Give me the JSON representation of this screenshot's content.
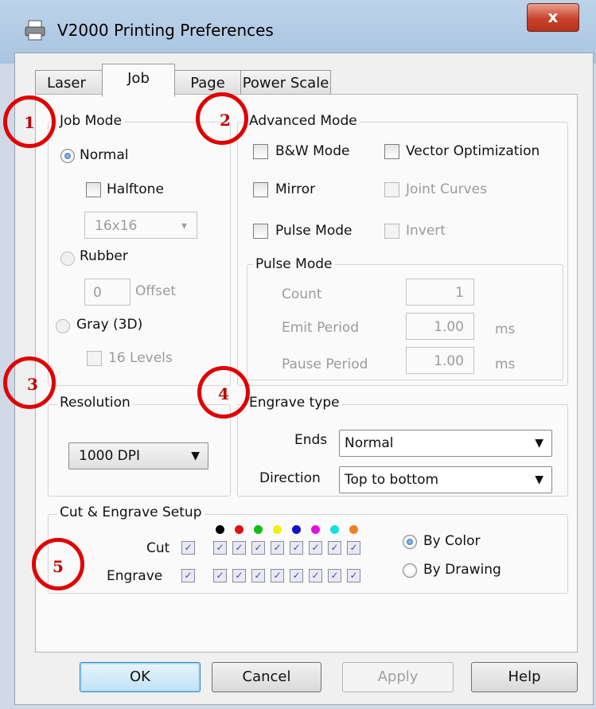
{
  "window": {
    "title": "V2000 Printing Preferences",
    "close_symbol": "x",
    "app_icon": "printer-icon"
  },
  "tabs": [
    {
      "label": "Laser",
      "active": false
    },
    {
      "label": "Job",
      "active": true
    },
    {
      "label": "Page",
      "active": false
    },
    {
      "label": "Power Scale",
      "active": false
    }
  ],
  "job_mode": {
    "title": "Job Mode",
    "normal": {
      "label": "Normal",
      "selected": true
    },
    "halftone": {
      "label": "Halftone",
      "checked": false
    },
    "halftone_size": "16x16",
    "rubber": {
      "label": "Rubber",
      "selected": false
    },
    "offset_value": "0",
    "offset_label": "Offset",
    "gray": {
      "label": "Gray (3D)",
      "selected": false
    },
    "levels": {
      "label": "16 Levels",
      "checked": false
    }
  },
  "advanced_mode": {
    "title": "Advanced Mode",
    "bw_mode": "B&W Mode",
    "vector_optimization": "Vector Optimization",
    "mirror": "Mirror",
    "joint_curves": "Joint Curves",
    "pulse_mode": "Pulse Mode",
    "invert": "Invert",
    "pulse_group": {
      "title": "Pulse Mode",
      "count_label": "Count",
      "count_value": "1",
      "emit_label": "Emit Period",
      "emit_value": "1.00",
      "emit_unit": "ms",
      "pause_label": "Pause Period",
      "pause_value": "1.00",
      "pause_unit": "ms"
    }
  },
  "resolution": {
    "title": "Resolution",
    "value": "1000 DPI"
  },
  "engrave_type": {
    "title": "Engrave type",
    "ends_label": "Ends",
    "ends_value": "Normal",
    "direction_label": "Direction",
    "direction_value": "Top to bottom"
  },
  "cut_engrave": {
    "title": "Cut & Engrave Setup",
    "cut_label": "Cut",
    "engrave_label": "Engrave",
    "check_mark": "✓",
    "colors": [
      "#000000",
      "#e01010",
      "#10c010",
      "#f0f010",
      "#1010d0",
      "#e010e0",
      "#10e0e0",
      "#f08020"
    ],
    "by_color": "By Color",
    "by_drawing": "By Drawing"
  },
  "buttons": {
    "ok": "OK",
    "cancel": "Cancel",
    "apply": "Apply",
    "help": "Help"
  },
  "markers": [
    "1",
    "2",
    "3",
    "4",
    "5"
  ],
  "arrow_glyph": "▼",
  "arrow_glyph_light": "▾"
}
